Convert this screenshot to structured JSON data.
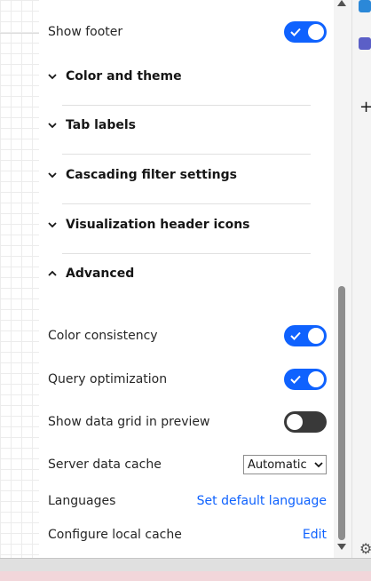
{
  "toggles": {
    "show_footer": {
      "label": "Show footer",
      "on": true
    }
  },
  "sections": [
    {
      "title": "Color and theme",
      "expanded": false
    },
    {
      "title": "Tab labels",
      "expanded": false
    },
    {
      "title": "Cascading filter settings",
      "expanded": false
    },
    {
      "title": "Visualization header icons",
      "expanded": false
    },
    {
      "title": "Advanced",
      "expanded": true
    }
  ],
  "advanced": {
    "color_consistency": {
      "label": "Color consistency",
      "on": true
    },
    "query_optimization": {
      "label": "Query optimization",
      "on": true
    },
    "show_data_grid": {
      "label": "Show data grid in preview",
      "on": false
    },
    "server_cache": {
      "label": "Server data cache",
      "value": "Automatic"
    },
    "languages": {
      "label": "Languages",
      "action": "Set default language"
    },
    "local_cache": {
      "label": "Configure local cache",
      "action": "Edit"
    }
  },
  "colors": {
    "accent": "#0f62fe",
    "toggle_off": "#393939"
  },
  "icons": [
    "scroll-up-icon",
    "scroll-down-icon",
    "chevron-down-icon",
    "chevron-up-icon",
    "plus-icon",
    "gear-icon"
  ]
}
